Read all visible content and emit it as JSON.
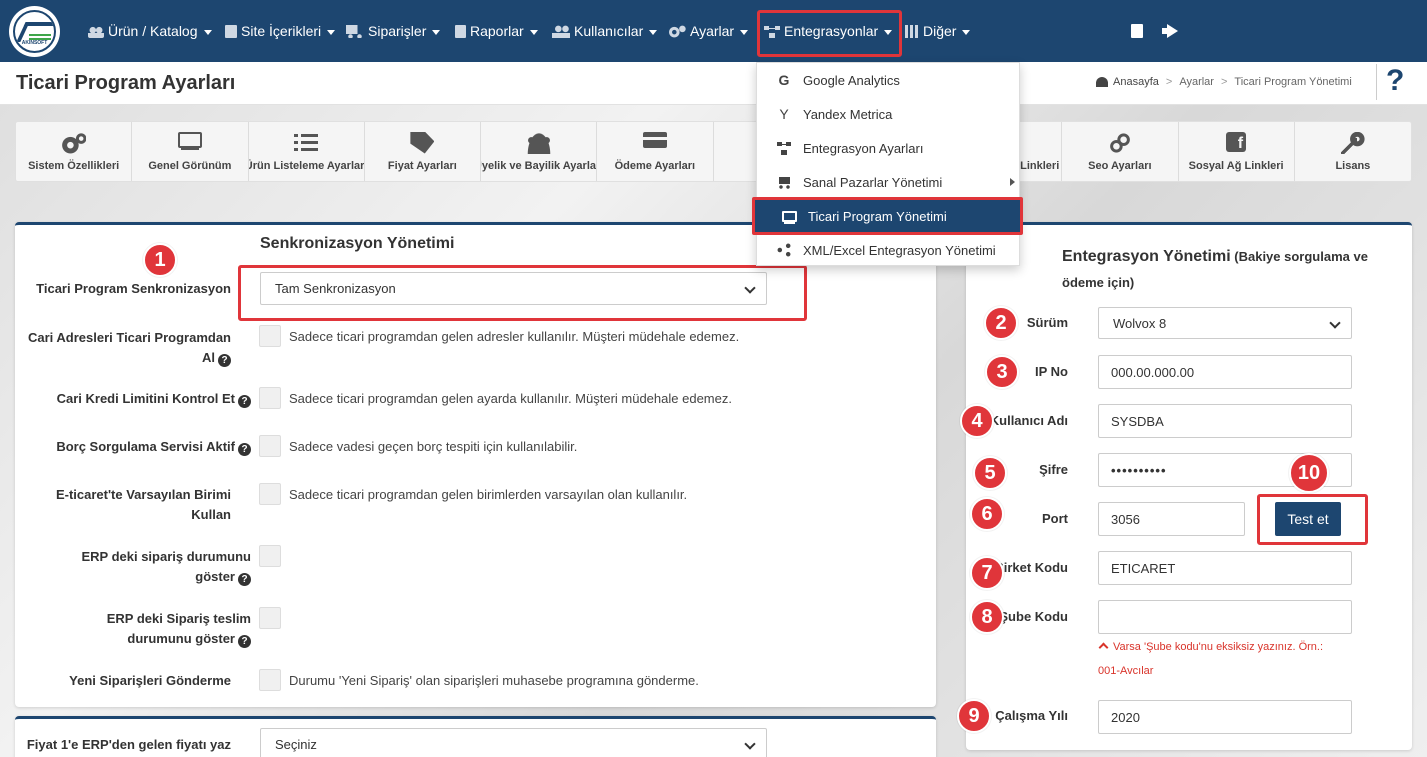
{
  "nav": {
    "logo_text": "AKINSOFT",
    "items": [
      {
        "label": "Ürün / Katalog"
      },
      {
        "label": "Site İçerikleri"
      },
      {
        "label": "Siparişler"
      },
      {
        "label": "Raporlar"
      },
      {
        "label": "Kullanıcılar"
      },
      {
        "label": "Ayarlar"
      },
      {
        "label": "Entegrasyonlar"
      },
      {
        "label": "Diğer"
      }
    ]
  },
  "header": {
    "title": "Ticari Program Ayarları",
    "breadcrumb": [
      "Anasayfa",
      "Ayarlar",
      "Ticari Program Yönetimi"
    ],
    "help": "?"
  },
  "toolbar": {
    "items": [
      {
        "label": "Sistem Özellikleri",
        "icon": "gears-icon"
      },
      {
        "label": "Genel Görünüm",
        "icon": "monitor-icon"
      },
      {
        "label": "Ürün Listeleme Ayarları",
        "icon": "list-icon"
      },
      {
        "label": "Fiyat Ayarları",
        "icon": "tags-icon"
      },
      {
        "label": "Üyelik ve Bayilik Ayarları",
        "icon": "users-icon"
      },
      {
        "label": "Ödeme Ayarları",
        "icon": "credit-card-icon"
      },
      {
        "label": "",
        "icon": ""
      },
      {
        "label": "",
        "icon": ""
      },
      {
        "label": "Linkleri",
        "icon": "link-icon"
      },
      {
        "label": "Seo Ayarları",
        "icon": "link-icon"
      },
      {
        "label": "Sosyal Ağ Linkleri",
        "icon": "facebook-icon"
      },
      {
        "label": "Lisans",
        "icon": "key-icon"
      }
    ]
  },
  "dropdown": {
    "items": [
      {
        "label": "Google Analytics",
        "icon": "google-icon"
      },
      {
        "label": "Yandex Metrica",
        "icon": "yandex-icon"
      },
      {
        "label": "Entegrasyon Ayarları",
        "icon": "sitemap-icon"
      },
      {
        "label": "Sanal Pazarlar Yönetimi",
        "icon": "cart-icon"
      },
      {
        "label": "Ticari Program Yönetimi",
        "icon": "laptop-icon"
      },
      {
        "label": "XML/Excel Entegrasyon Yönetimi",
        "icon": "share-icon"
      }
    ]
  },
  "sync": {
    "title": "Senkronizasyon Yönetimi",
    "sync_label": "Ticari Program Senkronizasyon",
    "sync_value": "Tam Senkronizasyon",
    "rows": [
      {
        "label_1": "Cari Adresleri Ticari Programdan",
        "label_2": "Al",
        "text": "Sadece ticari programdan gelen adresler kullanılır. Müşteri müdehale edemez."
      },
      {
        "label_1": "Cari Kredi Limitini Kontrol Et",
        "label_2": "",
        "text": "Sadece ticari programdan gelen ayarda kullanılır. Müşteri müdehale edemez."
      },
      {
        "label_1": "Borç Sorgulama Servisi Aktif",
        "label_2": "",
        "text": "Sadece vadesi geçen borç tespiti için kullanılabilir."
      },
      {
        "label_1": "E-ticaret'te Varsayılan Birimi",
        "label_2": "Kullan",
        "text": "Sadece ticari programdan gelen birimlerden varsayılan olan kullanılır."
      },
      {
        "label_1": "ERP deki sipariş durumunu",
        "label_2": "göster",
        "text": ""
      },
      {
        "label_1": "ERP deki Sipariş teslim",
        "label_2": "durumunu göster",
        "text": ""
      },
      {
        "label_1": "Yeni Siparişleri Gönderme",
        "label_2": "",
        "text": "Durumu 'Yeni Sipariş' olan siparişleri muhasebe programına gönderme."
      }
    ]
  },
  "price": {
    "label": "Fiyat 1'e ERP'den gelen fiyatı yaz",
    "value": "Seçiniz"
  },
  "integration": {
    "title": "Entegrasyon Yönetimi",
    "title_note_1": "(Bakiye sorgulama ve",
    "title_note_2": "ödeme için)",
    "fields": {
      "version_label": "Sürüm",
      "version_value": "Wolvox 8",
      "ip_label": "IP No",
      "ip_value": "000.00.000.00",
      "user_label": "Kullanıcı Adı",
      "user_value": "SYSDBA",
      "password_label": "Şifre",
      "password_value": "••••••••••",
      "port_label": "Port",
      "port_value": "3056",
      "company_label": "Şirket Kodu",
      "company_value": "ETICARET",
      "branch_label": "Şube Kodu",
      "branch_value": "",
      "branch_hint_1": "Varsa 'Şube kodu'nu eksiksiz yazınız. Örn.:",
      "branch_hint_2": "001-Avcılar",
      "year_label": "Çalışma Yılı",
      "year_value": "2020"
    },
    "test_button": "Test et"
  },
  "badges": [
    "1",
    "2",
    "3",
    "4",
    "5",
    "6",
    "7",
    "8",
    "9",
    "10"
  ],
  "colors": {
    "primary": "#1d4670",
    "highlight": "#e0353a"
  }
}
